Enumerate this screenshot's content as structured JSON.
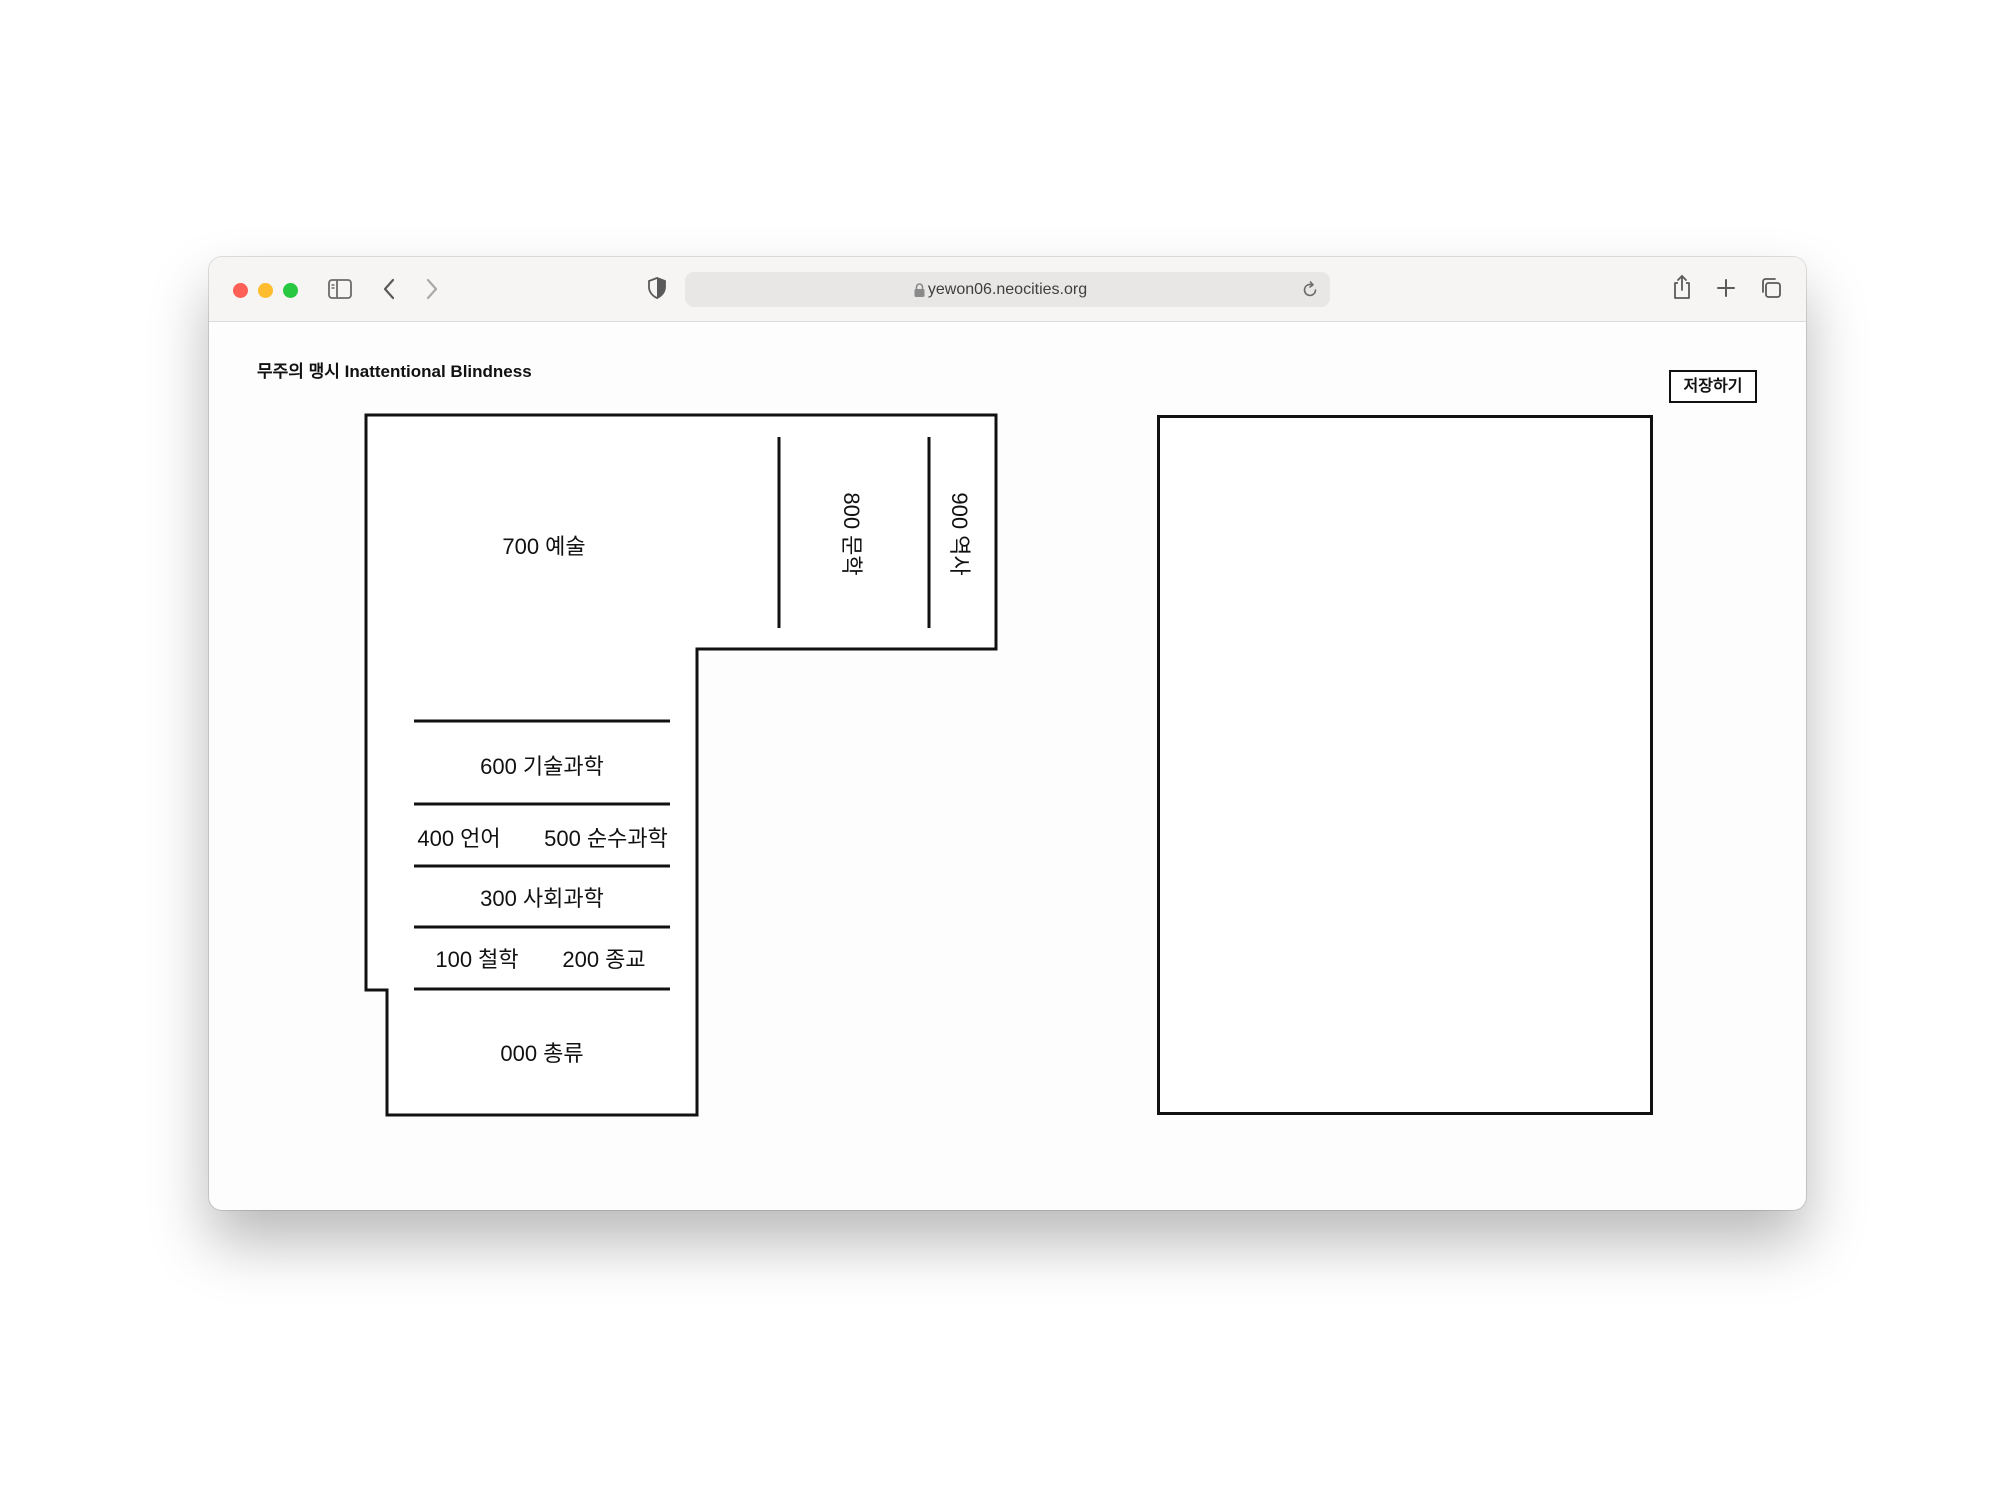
{
  "browser": {
    "url": "yewon06.neocities.org",
    "icons": [
      "sidebar-icon",
      "back-icon",
      "forward-icon",
      "privacy-shield-icon",
      "lock-icon",
      "reload-icon",
      "share-icon",
      "new-tab-icon",
      "tabs-overview-icon"
    ]
  },
  "page": {
    "title": "무주의 맹시 Inattentional Blindness",
    "save_label": "저장하기"
  },
  "floorplan": {
    "rooms": {
      "r700": "700 예술",
      "r800": "800 문학",
      "r900": "900 역사",
      "r600": "600 기술과학",
      "r400": "400 언어",
      "r500": "500 순수과학",
      "r300": "300 사회과학",
      "r100": "100 철학",
      "r200": "200 종교",
      "r000": "000 총류"
    }
  }
}
